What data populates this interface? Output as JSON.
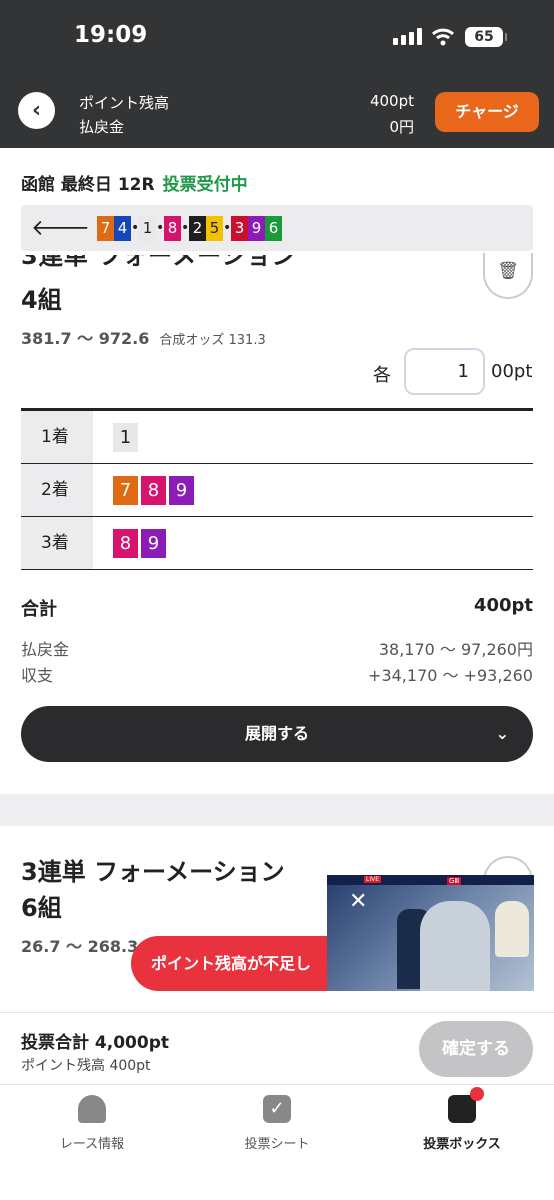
{
  "status": {
    "time": "19:09",
    "battery": "65"
  },
  "header": {
    "balance_label": "ポイント残高",
    "balance": "400pt",
    "payout_label": "払戻金",
    "payout": "0円",
    "charge": "チャージ"
  },
  "race": {
    "name": "函館 最終日 12R",
    "status": "投票受付中"
  },
  "combo": {
    "groups": [
      [
        "7",
        "4"
      ],
      [
        "1"
      ],
      [
        "8"
      ],
      [
        "2",
        "5"
      ],
      [
        "3",
        "9",
        "6"
      ]
    ]
  },
  "ticket1": {
    "title_cut": "3連単 フォーメーション",
    "title": "4組",
    "odds_range": "381.7 〜 972.6",
    "synth_label": "合成オッズ 131.3",
    "each": "各",
    "unit_value": "1",
    "unit": "00pt",
    "rows": [
      {
        "label": "1着",
        "nums": [
          "1"
        ]
      },
      {
        "label": "2着",
        "nums": [
          "7",
          "8",
          "9"
        ]
      },
      {
        "label": "3着",
        "nums": [
          "8",
          "9"
        ]
      }
    ],
    "total_label": "合計",
    "total": "400pt",
    "payout_label": "払戻金",
    "payout": "38,170 〜 97,260円",
    "balance_label": "収支",
    "balance": "+34,170 〜 +93,260",
    "expand": "展開する"
  },
  "ticket2": {
    "title": "3連単 フォーメーション",
    "combos": "6組",
    "odds_range": "26.7 〜 268.3"
  },
  "toast": "ポイント残高が不足し",
  "video": {
    "live": "LIVE",
    "grade": "GⅢ"
  },
  "footer": {
    "total": "投票合計 4,000pt",
    "balance": "ポイント残高 400pt",
    "confirm": "確定する"
  },
  "nav": [
    {
      "label": "レース情報"
    },
    {
      "label": "投票シート"
    },
    {
      "label": "投票ボックス"
    }
  ],
  "colors": {
    "1": "#e7e8ea",
    "2": "#1f1f1f",
    "3": "#c8102e",
    "4": "#1447b8",
    "5": "#f2c200",
    "6": "#1a9a38",
    "7": "#e06a14",
    "8": "#d6146e",
    "9": "#8b1cb8",
    "accent": "#e8671a",
    "status_green": "#1e9a48",
    "alert": "#e8323d"
  }
}
